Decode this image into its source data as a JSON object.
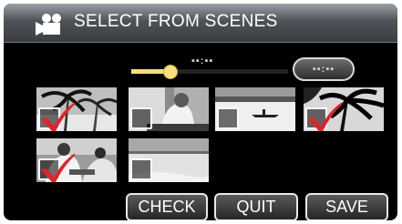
{
  "title": "SELECT FROM SCENES",
  "icons": {
    "title": "movie-camera-icon"
  },
  "slider": {
    "position_fraction": 0.25,
    "time_readout": "▪▪:▪▪",
    "total_readout": "▪▪:▪▪"
  },
  "thumbnails": [
    {
      "scene": "palm-trees-on-beach",
      "checked": true
    },
    {
      "scene": "person-at-window",
      "checked": false
    },
    {
      "scene": "lake-with-canoe",
      "checked": false
    },
    {
      "scene": "palm-tree-silhouette",
      "checked": true
    },
    {
      "scene": "people-at-table",
      "checked": true
    },
    {
      "scene": "sea-horizon",
      "checked": false
    }
  ],
  "buttons": {
    "check": "CHECK",
    "quit": "QUIT",
    "save": "SAVE"
  },
  "colors": {
    "accent": "#f3e07a",
    "checkmark": "#e0232b",
    "title_bar": "#4e5358"
  }
}
